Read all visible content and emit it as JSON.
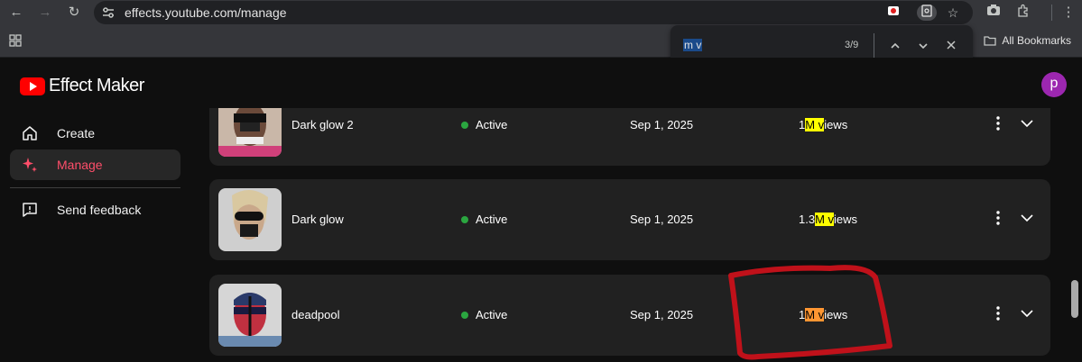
{
  "browser": {
    "url": "effects.youtube.com/manage",
    "bookmarks_label": "All Bookmarks"
  },
  "find_bar": {
    "query": "m v",
    "count": "3/9"
  },
  "app": {
    "title": "Effect Maker",
    "avatar_letter": "p"
  },
  "sidebar": {
    "items": [
      {
        "label": "Create",
        "icon": "home-icon"
      },
      {
        "label": "Manage",
        "icon": "sparkle-icon",
        "active": true
      },
      {
        "label": "Send feedback",
        "icon": "feedback-icon"
      }
    ]
  },
  "effects": {
    "rows": [
      {
        "name": "Dark glow 2",
        "status": "Active",
        "date": "Sep 1, 2025",
        "views_pre": "1",
        "views_hl": "M v",
        "views_post": "iews",
        "highlight": "yellow"
      },
      {
        "name": "Dark glow",
        "status": "Active",
        "date": "Sep 1, 2025",
        "views_pre": "1.3",
        "views_hl": "M v",
        "views_post": "iews",
        "highlight": "yellow"
      },
      {
        "name": "deadpool",
        "status": "Active",
        "date": "Sep 1, 2025",
        "views_pre": "1",
        "views_hl": "M v",
        "views_post": "iews",
        "highlight": "orange"
      }
    ]
  },
  "colors": {
    "accent_red": "#ff0000",
    "active_pink": "#ff4e6a",
    "status_green": "#2ba640",
    "find_current": "#ff9632",
    "find_match": "#ffff00",
    "annotation": "#c0111a"
  }
}
